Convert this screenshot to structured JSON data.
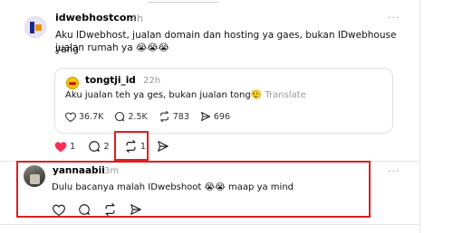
{
  "post": {
    "username": "idwebhostcom",
    "time": "4h",
    "more": "···",
    "text_line1": "Aku IDwebhost, jualan domain dan hosting ya gaes, bukan IDwebhouse yang",
    "text_line2": "jualan rumah ya 😭😭😭",
    "quote": {
      "username": "tongtji_id",
      "time": "22h",
      "text": "Aku jualan teh ya ges, bukan jualan tong😮‍💨",
      "translate": "Translate",
      "likes": "36.7K",
      "replies": "2.5K",
      "reposts": "783",
      "shares": "696"
    },
    "likes": "1",
    "replies": "2",
    "reposts": "1"
  },
  "reply": {
    "username": "yannaabii",
    "time": "3m",
    "more": "···",
    "text": "Dulu bacanya malah IDwebshoot 😭😭 maap ya mind"
  },
  "colors": {
    "highlight": "#dd1f1f",
    "like_active": "#ff2d55",
    "brand": "#1c2a8a"
  }
}
